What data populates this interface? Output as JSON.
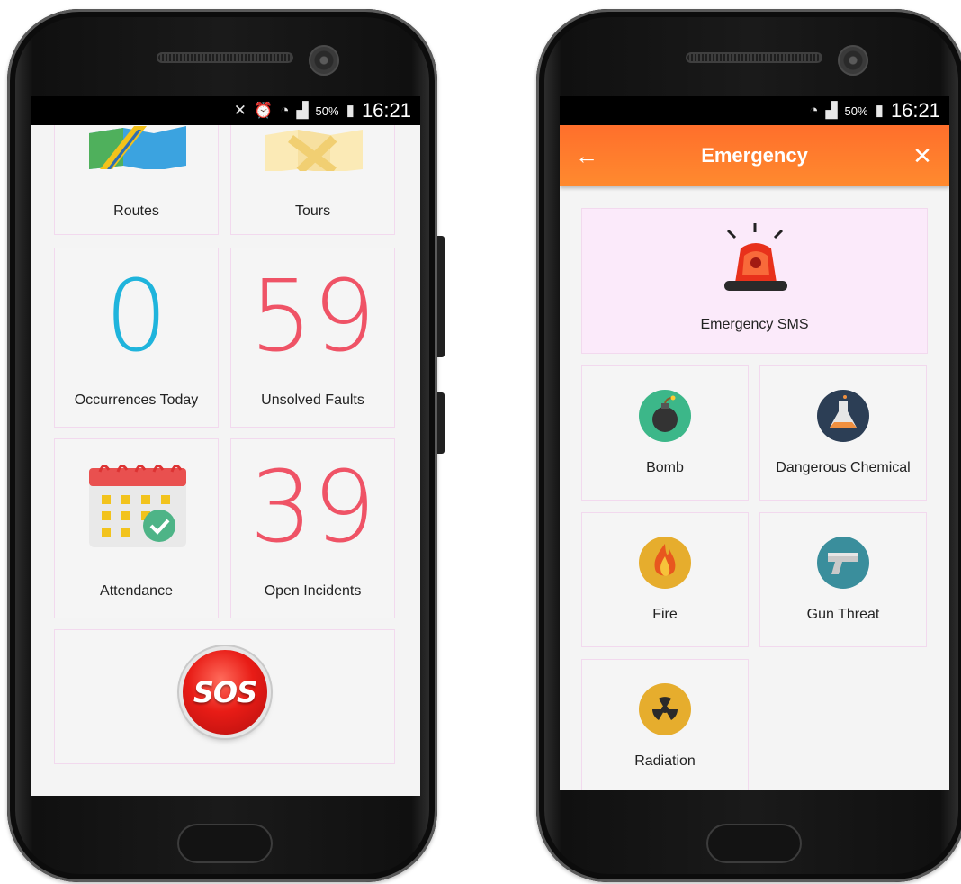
{
  "status_left": {
    "battery": "50%",
    "time": "16:21"
  },
  "status_right": {
    "battery": "50%",
    "time": "16:21"
  },
  "dashboard": {
    "routes_label": "Routes",
    "tours_label": "Tours",
    "occurrences_value": "0",
    "occurrences_label": "Occurrences Today",
    "faults_value": "59",
    "faults_label": "Unsolved Faults",
    "attendance_label": "Attendance",
    "incidents_value": "39",
    "incidents_label": "Open Incidents",
    "sos_label": "SOS"
  },
  "emergency": {
    "title": "Emergency",
    "back_icon": "arrow-left-icon",
    "close_icon": "close-icon",
    "sms_label": "Emergency SMS",
    "items": [
      {
        "label": "Bomb",
        "icon": "bomb-icon"
      },
      {
        "label": "Dangerous Chemical",
        "icon": "flask-icon"
      },
      {
        "label": "Fire",
        "icon": "fire-icon"
      },
      {
        "label": "Gun Threat",
        "icon": "gun-icon"
      },
      {
        "label": "Radiation",
        "icon": "radiation-icon"
      }
    ]
  },
  "colors": {
    "accent_orange": "#ff7a2e",
    "number_blue": "#1fb4dc",
    "number_red": "#ef5366",
    "sms_bg": "#fbeafa"
  }
}
